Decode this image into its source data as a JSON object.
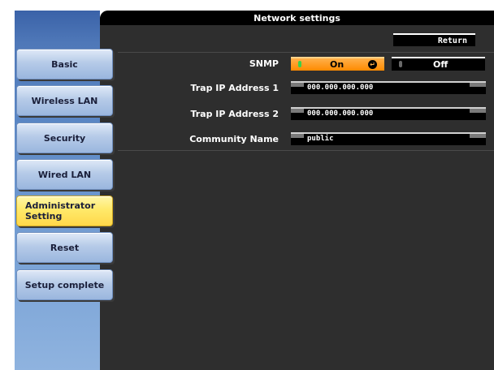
{
  "window": {
    "title": "Network settings"
  },
  "sidebar": {
    "items": [
      {
        "label": "Basic"
      },
      {
        "label": "Wireless LAN"
      },
      {
        "label": "Security"
      },
      {
        "label": "Wired LAN"
      },
      {
        "label": "Administrator Setting",
        "active": true
      },
      {
        "label": "Reset"
      },
      {
        "label": "Setup complete"
      }
    ]
  },
  "main": {
    "return_label": "Return",
    "snmp": {
      "label": "SNMP",
      "on_label": "On",
      "off_label": "Off",
      "selected": "On"
    },
    "trap1": {
      "label": "Trap IP Address 1",
      "value": "000.000.000.000"
    },
    "trap2": {
      "label": "Trap IP Address 2",
      "value": "000.000.000.000"
    },
    "community": {
      "label": "Community Name",
      "value": "public"
    }
  },
  "colors": {
    "accent_active": "#ffd84a",
    "toggle_on": "#ff8a00",
    "panel_bg": "#2e2e2e",
    "sidebar_bg": "#5a86c4"
  }
}
